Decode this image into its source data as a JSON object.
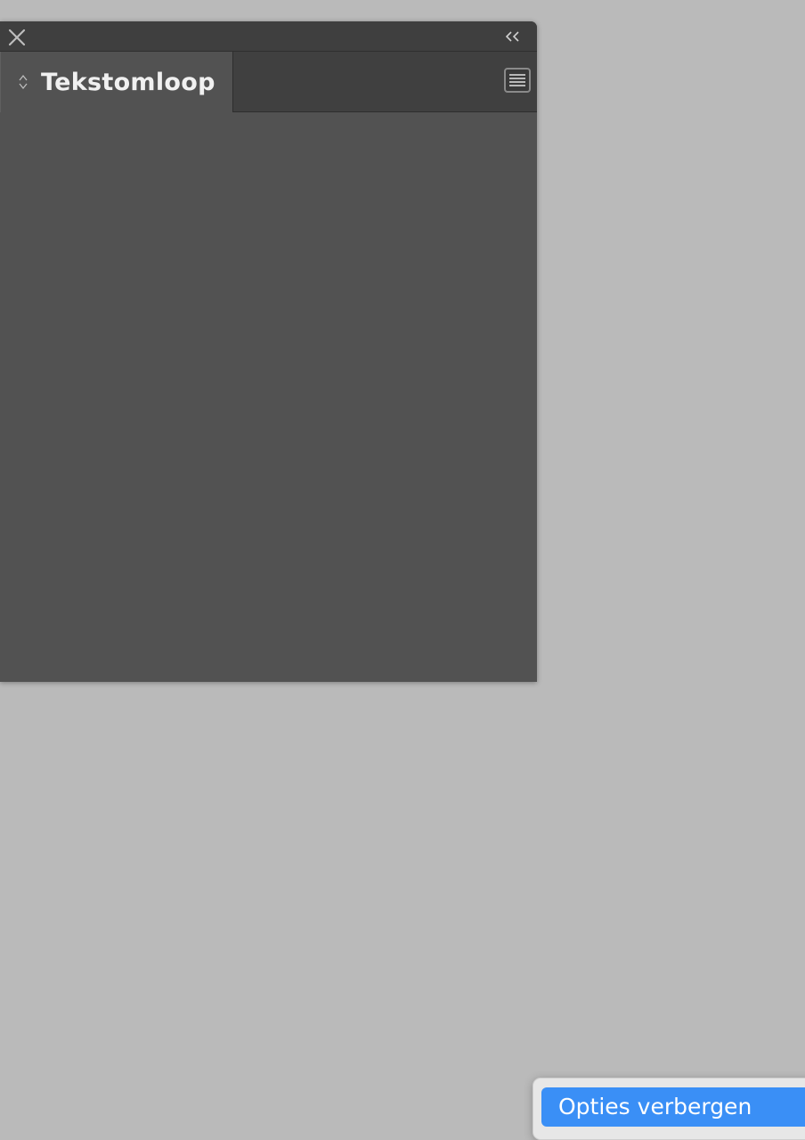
{
  "panel": {
    "title_tab": "Tekstomloop",
    "icons": {
      "close": "close-icon",
      "collapse": "double-chevron-left-icon",
      "tab_arrows": "up-down-arrows-icon",
      "menu": "panel-menu-icon"
    }
  },
  "context_menu": {
    "items": [
      {
        "label": "Opties verbergen",
        "highlighted": true
      }
    ]
  },
  "colors": {
    "background": "#bababa",
    "panel": "#525252",
    "panel_header": "#3f3f3f",
    "highlight": "#3a8ff6"
  }
}
